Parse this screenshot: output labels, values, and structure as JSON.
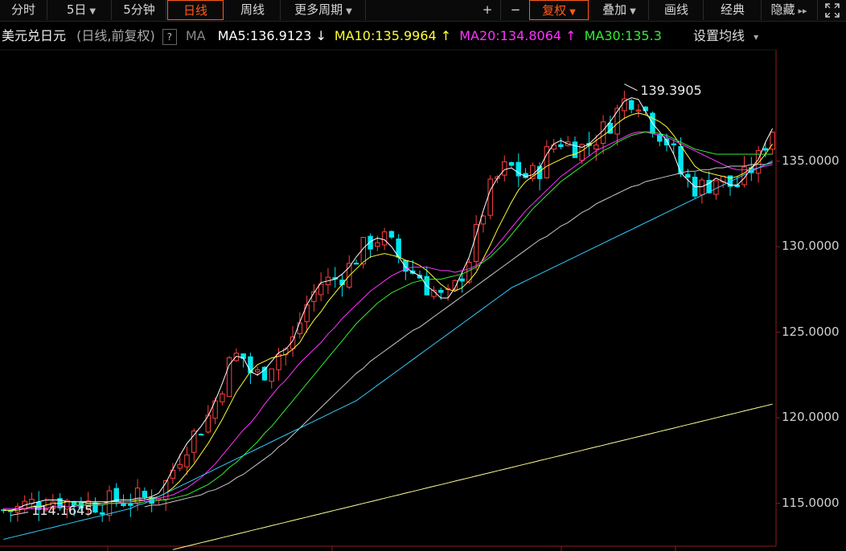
{
  "toolbar": {
    "items": [
      {
        "label": "分时",
        "caret": false,
        "active": false
      },
      {
        "label": "5日",
        "caret": true,
        "active": false
      },
      {
        "label": "5分钟",
        "caret": false,
        "active": false
      },
      {
        "label": "日线",
        "caret": false,
        "active": true
      },
      {
        "label": "周线",
        "caret": false,
        "active": false
      },
      {
        "label": "更多周期",
        "caret": true,
        "active": false
      }
    ],
    "right_items": [
      {
        "label": "+",
        "caret": false,
        "active": false
      },
      {
        "label": "−",
        "caret": false,
        "active": false
      },
      {
        "label": "复权",
        "caret": true,
        "active": true
      },
      {
        "label": "叠加",
        "caret": true,
        "active": false
      },
      {
        "label": "画线",
        "caret": false,
        "active": false
      },
      {
        "label": "经典",
        "caret": false,
        "active": false
      },
      {
        "label": "隐藏",
        "caret": false,
        "active": false
      }
    ],
    "hide_arrow": "▸▸",
    "fullscreen_icon": "fullscreen-icon"
  },
  "info": {
    "symbol": "美元兑日元",
    "mode": "(日线,前复权)",
    "qmark": "?",
    "ma_label": "MA",
    "ma_values": [
      {
        "text": "MA5:136.9123",
        "arrow": "↓",
        "color": "#ffffff"
      },
      {
        "text": "MA10:135.9964",
        "arrow": "↑",
        "color": "#ffff33"
      },
      {
        "text": "MA20:134.8064",
        "arrow": "↑",
        "color": "#ff33ff"
      },
      {
        "text": "MA30:135.3",
        "arrow": "",
        "color": "#33ee33"
      }
    ],
    "settings": "设置均线",
    "settings_caret": "▾"
  },
  "colors": {
    "up": "#ff4040",
    "down": "#00e5ee",
    "ma5": "#ffffff",
    "ma10": "#ffff33",
    "ma20": "#ff33ff",
    "ma30": "#33ee33",
    "ma60": "#c8c8c8",
    "ma120": "#33ccff",
    "ma250": "#ffff99",
    "grid": "#8b1c1c"
  },
  "chart_data": {
    "type": "candlestick",
    "ylim": [
      112.5,
      141.5
    ],
    "y_ticks": [
      "135.0000",
      "130.0000",
      "125.0000",
      "120.0000",
      "115.0000"
    ],
    "high_label": "139.3905",
    "low_label": "114.1645",
    "series": [
      {
        "name": "MA5",
        "values": [
          114.6,
          114.6,
          114.7,
          114.9,
          115.0,
          115.1,
          115.2,
          115.2,
          115.2,
          115.1,
          115.1,
          115.1,
          115.0,
          115.0,
          115.0,
          115.1,
          115.2,
          115.2,
          115.2,
          115.3,
          115.3,
          115.4,
          115.6,
          116.2,
          117.0,
          117.8,
          118.5,
          119.0,
          119.5,
          120.1,
          121.0,
          122.0,
          123.1,
          123.6,
          123.5,
          122.7,
          122.5,
          122.8,
          123.3,
          123.8,
          124.0,
          124.5,
          125.6,
          126.6,
          127.3,
          127.9,
          128.0,
          128.1,
          128.4,
          128.8,
          129.4,
          129.9,
          130.3,
          130.5,
          130.4,
          130.0,
          129.4,
          128.8,
          128.5,
          128.3,
          127.7,
          127.4,
          127.0,
          127.0,
          127.6,
          128.5,
          129.4,
          130.7,
          132.1,
          133.3,
          134.0,
          134.5,
          134.6,
          134.3,
          134.1,
          134.2,
          134.6,
          135.4,
          136.0,
          136.2,
          136.0,
          135.9,
          135.8,
          136.0,
          136.4,
          136.8,
          137.3,
          137.9,
          138.5,
          138.7,
          138.6,
          137.9,
          137.2,
          136.7,
          136.2,
          135.4,
          134.3,
          133.9,
          133.5,
          133.5,
          133.7,
          134.0,
          133.8,
          133.6,
          133.6,
          134.0,
          134.6,
          135.1,
          136.1,
          136.9
        ]
      },
      {
        "name": "MA10",
        "values": [
          114.6,
          114.6,
          114.6,
          114.7,
          114.8,
          114.8,
          114.9,
          115.0,
          115.0,
          115.1,
          115.1,
          115.1,
          115.1,
          115.1,
          115.1,
          115.1,
          115.1,
          115.1,
          115.1,
          115.2,
          115.2,
          115.3,
          115.4,
          115.6,
          115.9,
          116.3,
          116.8,
          117.3,
          117.9,
          118.5,
          119.2,
          119.9,
          120.7,
          121.5,
          122.1,
          122.7,
          123.1,
          123.3,
          123.5,
          123.6,
          123.7,
          124.0,
          124.4,
          125.1,
          125.7,
          126.2,
          126.8,
          127.3,
          127.8,
          128.3,
          128.7,
          129.1,
          129.4,
          129.5,
          129.6,
          129.5,
          129.4,
          129.2,
          129.1,
          128.9,
          128.6,
          128.2,
          127.8,
          127.5,
          127.4,
          127.6,
          128.0,
          128.5,
          129.3,
          130.1,
          131.0,
          131.8,
          132.6,
          133.3,
          133.8,
          134.1,
          134.4,
          134.7,
          134.9,
          135.1,
          135.3,
          135.4,
          135.6,
          135.9,
          136.2,
          136.5,
          136.8,
          137.2,
          137.5,
          137.7,
          137.8,
          137.7,
          137.5,
          137.3,
          137.0,
          136.5,
          135.9,
          135.3,
          134.7,
          134.4,
          134.3,
          134.2,
          134.1,
          134.0,
          134.1,
          134.3,
          134.6,
          134.9,
          135.4,
          136.0
        ]
      },
      {
        "name": "MA20",
        "values": [
          114.7,
          114.7,
          114.7,
          114.7,
          114.7,
          114.7,
          114.7,
          114.8,
          114.8,
          114.8,
          114.8,
          114.9,
          114.9,
          114.9,
          115.0,
          115.0,
          115.0,
          115.1,
          115.1,
          115.1,
          115.2,
          115.2,
          115.3,
          115.4,
          115.5,
          115.7,
          115.9,
          116.2,
          116.5,
          116.9,
          117.3,
          117.8,
          118.3,
          118.8,
          119.3,
          119.7,
          120.2,
          120.8,
          121.3,
          121.8,
          122.2,
          122.7,
          123.2,
          123.6,
          124.0,
          124.4,
          124.9,
          125.3,
          125.8,
          126.2,
          126.6,
          127.0,
          127.4,
          127.7,
          128.0,
          128.3,
          128.5,
          128.7,
          128.8,
          128.8,
          128.8,
          128.7,
          128.6,
          128.6,
          128.5,
          128.6,
          128.7,
          128.9,
          129.2,
          129.6,
          130.1,
          130.6,
          131.1,
          131.6,
          132.1,
          132.5,
          132.9,
          133.3,
          133.7,
          134.1,
          134.4,
          134.7,
          135.0,
          135.3,
          135.6,
          135.8,
          136.0,
          136.2,
          136.4,
          136.6,
          136.7,
          136.7,
          136.6,
          136.5,
          136.4,
          136.2,
          136.0,
          135.8,
          135.6,
          135.4,
          135.2,
          135.0,
          134.8,
          134.6,
          134.5,
          134.5,
          134.5,
          134.6,
          134.7,
          134.8
        ]
      },
      {
        "name": "MA30",
        "values": [
          null,
          null,
          null,
          null,
          null,
          null,
          null,
          null,
          null,
          null,
          114.9,
          114.9,
          114.9,
          114.9,
          114.9,
          115.0,
          115.0,
          115.0,
          115.0,
          115.0,
          115.1,
          115.1,
          115.2,
          115.2,
          115.3,
          115.4,
          115.5,
          115.7,
          115.9,
          116.1,
          116.4,
          116.7,
          117.1,
          117.4,
          117.8,
          118.2,
          118.6,
          119.1,
          119.5,
          120.0,
          120.5,
          121.0,
          121.5,
          122.0,
          122.5,
          123.0,
          123.5,
          124.0,
          124.5,
          125.0,
          125.5,
          125.9,
          126.3,
          126.7,
          127.0,
          127.3,
          127.5,
          127.7,
          127.9,
          128.0,
          128.1,
          128.1,
          128.1,
          128.2,
          128.3,
          128.4,
          128.6,
          128.8,
          129.1,
          129.4,
          129.8,
          130.2,
          130.7,
          131.2,
          131.7,
          132.2,
          132.6,
          133.0,
          133.4,
          133.8,
          134.1,
          134.4,
          134.7,
          135.0,
          135.3,
          135.6,
          135.8,
          136.1,
          136.3,
          136.5,
          136.6,
          136.7,
          136.7,
          136.6,
          136.5,
          136.3,
          136.1,
          135.9,
          135.7,
          135.6,
          135.5,
          135.4,
          135.4,
          135.4,
          135.4,
          135.4,
          135.4,
          135.4,
          135.4,
          135.4
        ]
      },
      {
        "name": "MA60",
        "values": [
          null,
          null,
          null,
          null,
          null,
          null,
          null,
          null,
          null,
          null,
          null,
          null,
          null,
          null,
          null,
          null,
          null,
          null,
          null,
          null,
          114.8,
          114.9,
          114.9,
          115.0,
          115.1,
          115.2,
          115.3,
          115.4,
          115.5,
          115.7,
          115.8,
          116.0,
          116.2,
          116.5,
          116.7,
          117.0,
          117.3,
          117.6,
          117.9,
          118.3,
          118.6,
          119.0,
          119.4,
          119.8,
          120.2,
          120.6,
          121.0,
          121.4,
          121.8,
          122.2,
          122.6,
          122.9,
          123.3,
          123.6,
          123.9,
          124.2,
          124.5,
          124.8,
          125.1,
          125.3,
          125.6,
          125.9,
          126.2,
          126.5,
          126.8,
          127.1,
          127.4,
          127.7,
          128.0,
          128.3,
          128.6,
          128.9,
          129.2,
          129.5,
          129.8,
          130.1,
          130.4,
          130.6,
          130.9,
          131.2,
          131.4,
          131.7,
          132.0,
          132.2,
          132.5,
          132.7,
          132.9,
          133.1,
          133.3,
          133.5,
          133.6,
          133.8,
          133.9,
          134.0,
          134.1,
          134.2,
          134.3,
          134.4,
          134.4,
          134.5,
          134.5,
          134.6,
          134.6,
          134.7,
          134.7,
          134.7,
          134.8,
          134.8,
          134.8,
          134.9
        ]
      },
      {
        "name": "MA120",
        "values": [
          112.9,
          113.0,
          113.1,
          113.2,
          113.3,
          113.4,
          113.5,
          113.6,
          113.7,
          113.8,
          113.9,
          114.0,
          114.1,
          114.2,
          114.3,
          114.4,
          114.5,
          114.6,
          114.7,
          114.9,
          115.0,
          115.2,
          115.4,
          115.6,
          115.8,
          116.0,
          116.2,
          116.4,
          116.6,
          116.8,
          117.0,
          117.2,
          117.4,
          117.6,
          117.8,
          118.0,
          118.2,
          118.4,
          118.6,
          118.8,
          119.0,
          119.2,
          119.4,
          119.6,
          119.8,
          120.0,
          120.2,
          120.4,
          120.6,
          120.8,
          121.0,
          121.3,
          121.6,
          121.9,
          122.2,
          122.5,
          122.8,
          123.1,
          123.4,
          123.7,
          124.0,
          124.3,
          124.6,
          124.9,
          125.2,
          125.5,
          125.8,
          126.1,
          126.4,
          126.7,
          127.0,
          127.3,
          127.6,
          127.8,
          128.0,
          128.2,
          128.4,
          128.6,
          128.8,
          129.0,
          129.2,
          129.4,
          129.6,
          129.8,
          130.0,
          130.2,
          130.4,
          130.6,
          130.8,
          131.0,
          131.2,
          131.4,
          131.6,
          131.8,
          132.0,
          132.2,
          132.4,
          132.6,
          132.8,
          133.0,
          133.2,
          133.4,
          133.6,
          133.8,
          134.0,
          134.2,
          134.4,
          134.6,
          134.8,
          135.0
        ]
      },
      {
        "name": "MA250",
        "values": [
          null,
          null,
          null,
          null,
          null,
          null,
          null,
          null,
          null,
          null,
          null,
          null,
          null,
          null,
          null,
          null,
          null,
          null,
          null,
          null,
          null,
          null,
          null,
          null,
          112.3,
          112.4,
          112.5,
          112.6,
          112.7,
          112.8,
          112.9,
          113.0,
          113.1,
          113.2,
          113.3,
          113.4,
          113.5,
          113.6,
          113.7,
          113.8,
          113.9,
          114.0,
          114.1,
          114.2,
          114.3,
          114.4,
          114.5,
          114.6,
          114.7,
          114.8,
          114.9,
          115.0,
          115.1,
          115.2,
          115.3,
          115.4,
          115.5,
          115.6,
          115.7,
          115.8,
          115.9,
          116.0,
          116.1,
          116.2,
          116.3,
          116.4,
          116.5,
          116.6,
          116.7,
          116.8,
          116.9,
          117.0,
          117.1,
          117.2,
          117.3,
          117.4,
          117.5,
          117.6,
          117.7,
          117.8,
          117.9,
          118.0,
          118.1,
          118.2,
          118.3,
          118.4,
          118.5,
          118.6,
          118.7,
          118.8,
          118.9,
          119.0,
          119.1,
          119.2,
          119.3,
          119.4,
          119.5,
          119.6,
          119.7,
          119.8,
          119.9,
          120.0,
          120.1,
          120.2,
          120.3,
          120.4,
          120.5,
          120.6,
          120.7,
          120.8
        ]
      }
    ]
  }
}
